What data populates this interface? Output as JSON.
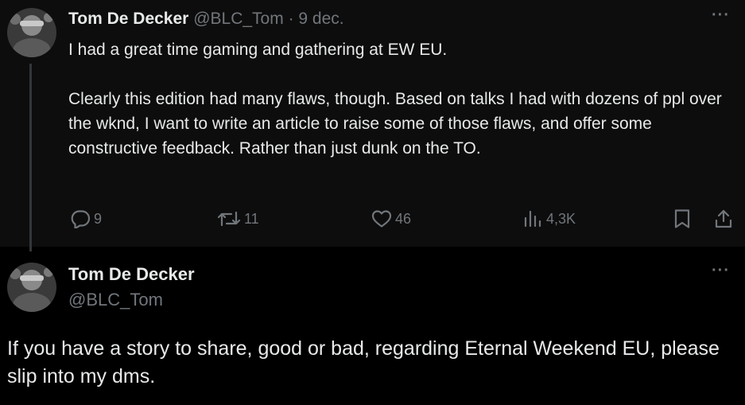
{
  "tweet1": {
    "author_name": "Tom De Decker",
    "handle": "@BLC_Tom",
    "separator": "·",
    "date": "9 dec.",
    "paragraphs": [
      "I had a great time gaming and gathering at EW EU.",
      "Clearly this edition had many flaws, though. Based on talks I had with dozens of ppl over the wknd, I want to write an article to raise some of those flaws, and offer some constructive feedback. Rather than just dunk on the TO."
    ],
    "actions": {
      "replies": "9",
      "reposts": "11",
      "likes": "46",
      "views": "4,3K"
    },
    "more_label": "···"
  },
  "tweet2": {
    "author_name": "Tom De Decker",
    "handle": "@BLC_Tom",
    "text": "If you have a story to share, good or bad, regarding Eternal Weekend EU, please slip into my dms.",
    "more_label": "···"
  },
  "colors": {
    "background": "#000000",
    "text": "#e7e9ea",
    "muted": "#71767b",
    "thread_line": "#333639"
  },
  "icons": [
    "reply-icon",
    "repost-icon",
    "like-icon",
    "views-icon",
    "bookmark-icon",
    "share-icon",
    "more-icon"
  ]
}
